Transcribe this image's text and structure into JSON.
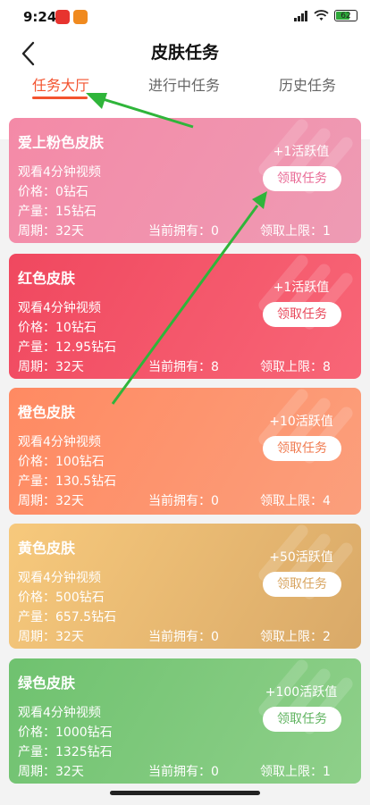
{
  "status_bar": {
    "time": "9:24",
    "battery": "62"
  },
  "header": {
    "title": "皮肤任务",
    "tabs": [
      "任务大厅",
      "进行中任务",
      "历史任务"
    ],
    "active_tab": 0,
    "accent_color": "#f3532f"
  },
  "cards": [
    {
      "name": "爱上粉色皮肤",
      "desc": "观看4分钟视频",
      "price": "价格：0钻石",
      "output": "产量：15钻石",
      "period": "周期：32天",
      "owned": "当前拥有：0",
      "limit": "领取上限：1",
      "active_value": "+1活跃值",
      "button": "领取任务",
      "button_color": "#e96a95",
      "gradient": [
        "#f48aa7",
        "#ee9bb4"
      ]
    },
    {
      "name": "红色皮肤",
      "desc": "观看4分钟视频",
      "price": "价格：10钻石",
      "output": "产量：12.95钻石",
      "period": "周期：32天",
      "owned": "当前拥有：8",
      "limit": "领取上限：8",
      "active_value": "+1活跃值",
      "button": "领取任务",
      "button_color": "#e8475a",
      "gradient": [
        "#f0485f",
        "#f86677"
      ]
    },
    {
      "name": "橙色皮肤",
      "desc": "观看4分钟视频",
      "price": "价格：100钻石",
      "output": "产量：130.5钻石",
      "period": "周期：32天",
      "owned": "当前拥有：0",
      "limit": "领取上限：4",
      "active_value": "+10活跃值",
      "button": "领取任务",
      "button_color": "#f07a4f",
      "gradient": [
        "#ff8a62",
        "#fb9f7c"
      ]
    },
    {
      "name": "黄色皮肤",
      "desc": "观看4分钟视频",
      "price": "价格：500钻石",
      "output": "产量：657.5钻石",
      "period": "周期：32天",
      "owned": "当前拥有：0",
      "limit": "领取上限：2",
      "active_value": "+50活跃值",
      "button": "领取任务",
      "button_color": "#d8a45e",
      "gradient": [
        "#f7c97c",
        "#d9a968"
      ]
    },
    {
      "name": "绿色皮肤",
      "desc": "观看4分钟视频",
      "price": "价格：1000钻石",
      "output": "产量：1325钻石",
      "period": "周期：32天",
      "owned": "当前拥有：0",
      "limit": "领取上限：1",
      "active_value": "+100活跃值",
      "button": "领取任务",
      "button_color": "#5fb35f",
      "gradient": [
        "#6fc26f",
        "#8fd08a"
      ]
    }
  ],
  "annotation_color": "#2fb53a"
}
